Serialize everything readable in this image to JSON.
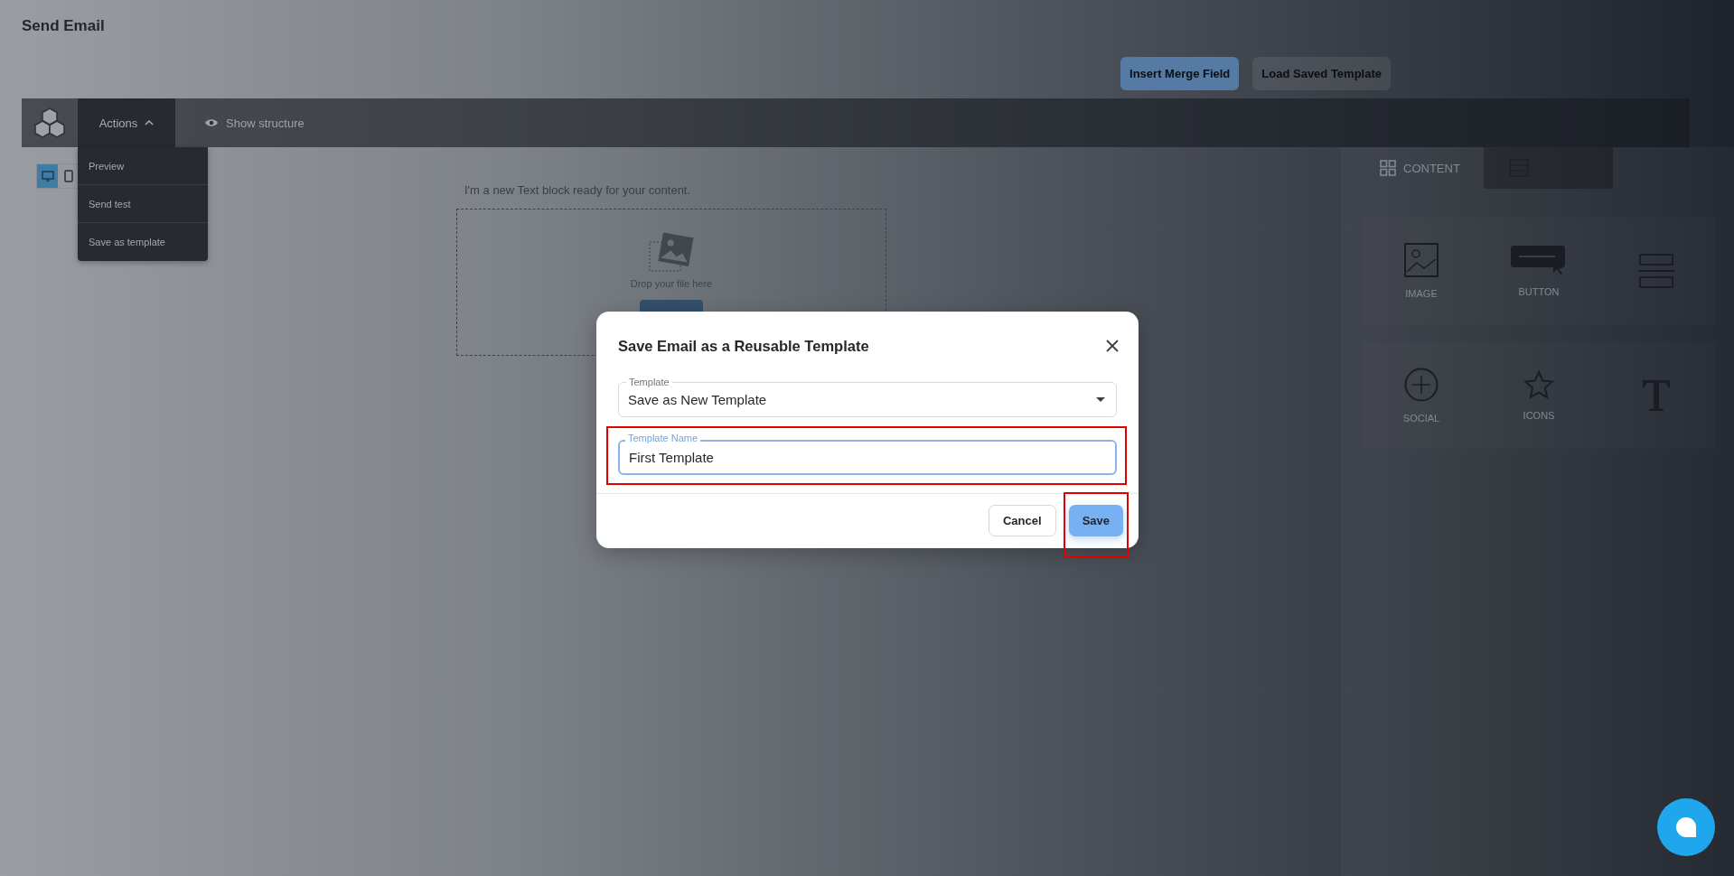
{
  "page": {
    "title": "Send Email"
  },
  "top_actions": [
    {
      "label": "Insert Merge Field",
      "kind": "primary"
    },
    {
      "label": "Load Saved Template",
      "kind": "plain"
    }
  ],
  "toolbar": {
    "actions": {
      "label": "Actions",
      "expanded": true
    },
    "show_structure": "Show structure"
  },
  "actions_menu": [
    "Preview",
    "Send test",
    "Save as template"
  ],
  "device_toggle": [
    {
      "kind": "desktop",
      "selected": true
    },
    {
      "kind": "tablet",
      "selected": false
    }
  ],
  "canvas": {
    "text_block": "I'm a new Text block ready for your content.",
    "image_drop": "Drop your file here"
  },
  "side_panel": {
    "tabs": [
      {
        "kind": "grid",
        "label": "CONTENT",
        "selected": true
      },
      {
        "kind": "rows",
        "selected": false
      }
    ],
    "blocks": [
      {
        "kind": "image",
        "label": "IMAGE"
      },
      {
        "kind": "button",
        "label": "BUTTON"
      },
      {
        "kind": "divider"
      },
      {
        "kind": "social",
        "label": "SOCIAL"
      },
      {
        "kind": "star",
        "label": "ICONS"
      },
      {
        "kind": "text"
      }
    ]
  },
  "dialog": {
    "title": "Save Email as a Reusable Template",
    "template_select": {
      "label": "Template",
      "value": "Save as New Template",
      "highlighted": false
    },
    "name_field": {
      "label": "Template Name",
      "value": "First Template",
      "highlighted": true
    },
    "buttons": [
      {
        "label": "Cancel",
        "kind": "secondary",
        "highlighted": false
      },
      {
        "label": "Save",
        "kind": "primary",
        "highlighted": true
      }
    ]
  }
}
